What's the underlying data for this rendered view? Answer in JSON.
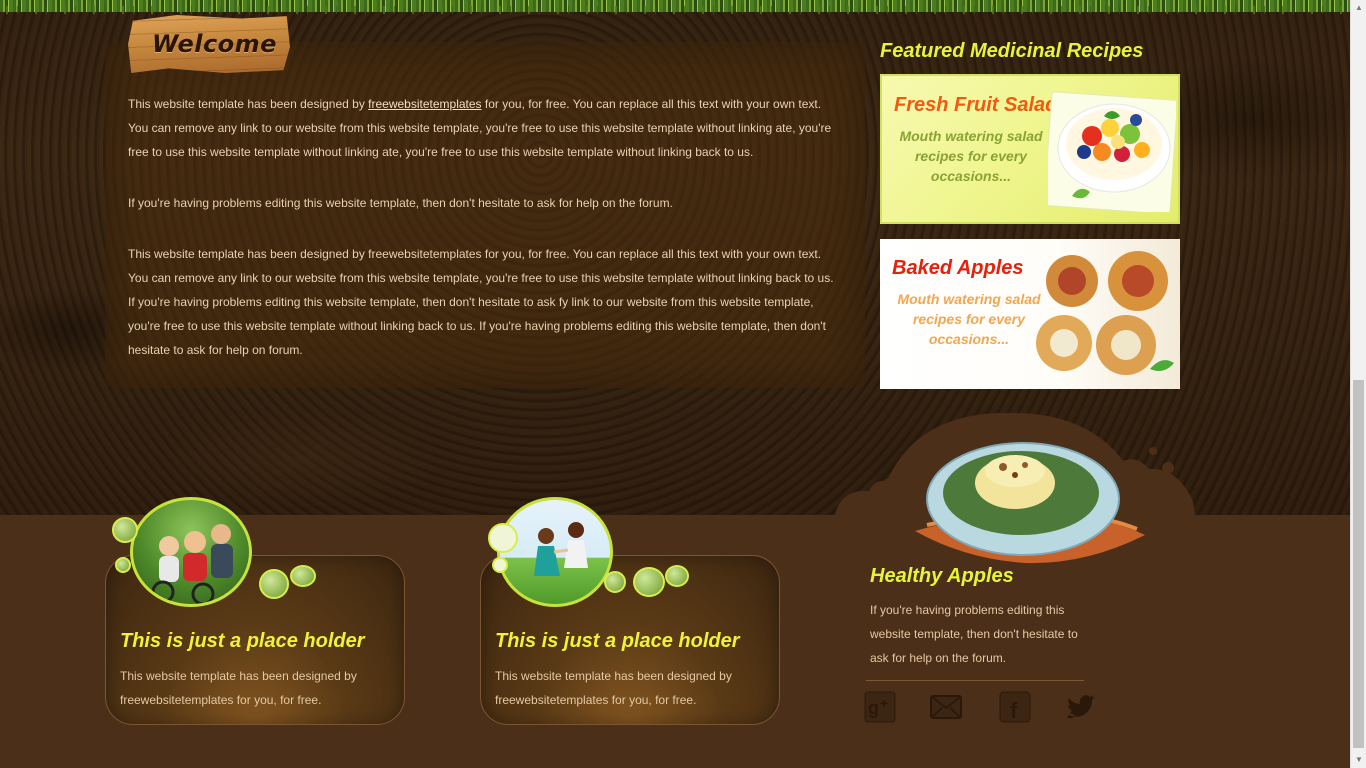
{
  "welcome": {
    "title": "Welcome",
    "p1_before_link": "This website template has been designed by ",
    "p1_link": "freewebsitetemplates",
    "p1_after_link": " for you, for free. You can replace all this text with your own text. You can remove any link to our website from this website template, you're free to use this website template without linking ate, you're free to use this website template without linking ate, you're free to use this website template without linking back to us.",
    "p2": "If you're having problems editing this website template, then don't hesitate to ask for help on the forum.",
    "p3": "This website template has been designed by freewebsitetemplates for you, for free. You can replace all this text with your own text. You can remove any link to our website from this website template, you're free to use this website template without linking back to us. If you're having problems editing this website template, then don't hesitate to ask fy link to our website from this website template, you're free to use this website template without linking back to us. If you're having problems editing this website template, then don't hesitate to ask for help on forum."
  },
  "featured": {
    "heading": "Featured Medicinal Recipes",
    "recipes": [
      {
        "title": "Fresh Fruit Salad",
        "description": "Mouth watering salad recipes for every occasions...",
        "accent": "#f05a12"
      },
      {
        "title": "Baked Apples",
        "description": "Mouth watering salad recipes for every occasions...",
        "accent": "#e5210d"
      }
    ]
  },
  "footer": {
    "cards": [
      {
        "title": "This is just a place holder",
        "text": "This website template has been designed by freewebsitetemplates for you, for free."
      },
      {
        "title": "This is just a place holder",
        "text": "This website template has been designed by freewebsitetemplates for you, for free."
      }
    ],
    "healthy": {
      "title": "Healthy Apples",
      "text": "If you're having problems editing this website template, then don't hesitate to ask for help on the forum."
    },
    "social": [
      "google-plus-icon",
      "mail-icon",
      "facebook-icon",
      "twitter-icon"
    ]
  },
  "colors": {
    "heading_yellow": "#e8f43a",
    "soil": "#33210f",
    "footer_brown": "#4b2f18",
    "body_text": "#e9d2b2"
  }
}
